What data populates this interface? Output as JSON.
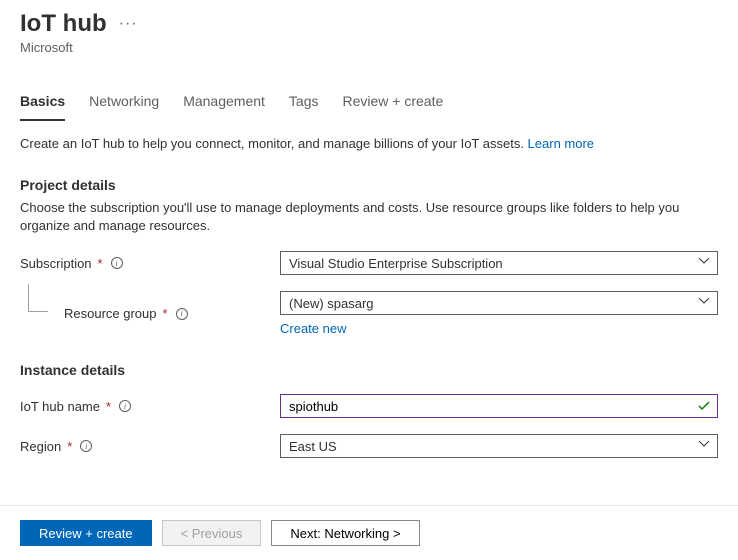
{
  "header": {
    "title": "IoT hub",
    "subtitle": "Microsoft"
  },
  "tabs": {
    "basics": "Basics",
    "networking": "Networking",
    "management": "Management",
    "tags": "Tags",
    "review": "Review + create"
  },
  "intro": {
    "text": "Create an IoT hub to help you connect, monitor, and manage billions of your IoT assets. ",
    "learn_more": "Learn more"
  },
  "project": {
    "title": "Project details",
    "desc": "Choose the subscription you'll use to manage deployments and costs. Use resource groups like folders to help you organize and manage resources.",
    "subscription_label": "Subscription",
    "subscription_value": "Visual Studio Enterprise Subscription",
    "rg_label": "Resource group",
    "rg_value": "(New) spasarg",
    "create_new": "Create new"
  },
  "instance": {
    "title": "Instance details",
    "name_label": "IoT hub name",
    "name_value": "spiothub",
    "region_label": "Region",
    "region_value": "East US"
  },
  "footer": {
    "review": "Review + create",
    "prev": "< Previous",
    "next": "Next: Networking >"
  }
}
